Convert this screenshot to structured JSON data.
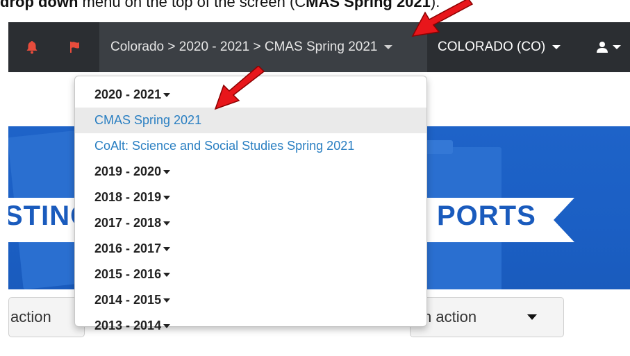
{
  "document": {
    "text_bold_1": "drop down",
    "text_plain": " menu on the top of the screen (C",
    "text_bold_2": "MAS Spring 2021",
    "text_end": ")."
  },
  "navbar": {
    "breadcrumb": "Colorado > 2020 - 2021 > CMAS Spring 2021",
    "state_label": "COLORADO (CO)",
    "icons": [
      "bell-icon",
      "flag-icon",
      "user-icon"
    ],
    "background": "#2b2e32",
    "active_background": "#3b3f44"
  },
  "hero": {
    "banner_left": "STING",
    "banner_right": "PORTS",
    "color": "#1b5fc4"
  },
  "actions": {
    "left_label": "action",
    "right_label": "n action"
  },
  "dropdown": {
    "items": [
      {
        "label": "2020 - 2021",
        "kind": "year",
        "has_caret": true
      },
      {
        "label": "CMAS Spring 2021",
        "kind": "link",
        "active": true
      },
      {
        "label": "CoAlt: Science and Social Studies Spring 2021",
        "kind": "link"
      },
      {
        "label": "2019 - 2020",
        "kind": "year",
        "has_caret": true
      },
      {
        "label": "2018 - 2019",
        "kind": "year",
        "has_caret": true
      },
      {
        "label": "2017 - 2018",
        "kind": "year",
        "has_caret": true
      },
      {
        "label": "2016 - 2017",
        "kind": "year",
        "has_caret": true
      },
      {
        "label": "2015 - 2016",
        "kind": "year",
        "has_caret": true
      },
      {
        "label": "2014 - 2015",
        "kind": "year",
        "has_caret": true
      },
      {
        "label": "2013 - 2014",
        "kind": "year",
        "has_caret": true
      }
    ],
    "link_color": "#2a7fc2"
  },
  "annotations": {
    "arrow_color": "#e8161b"
  }
}
